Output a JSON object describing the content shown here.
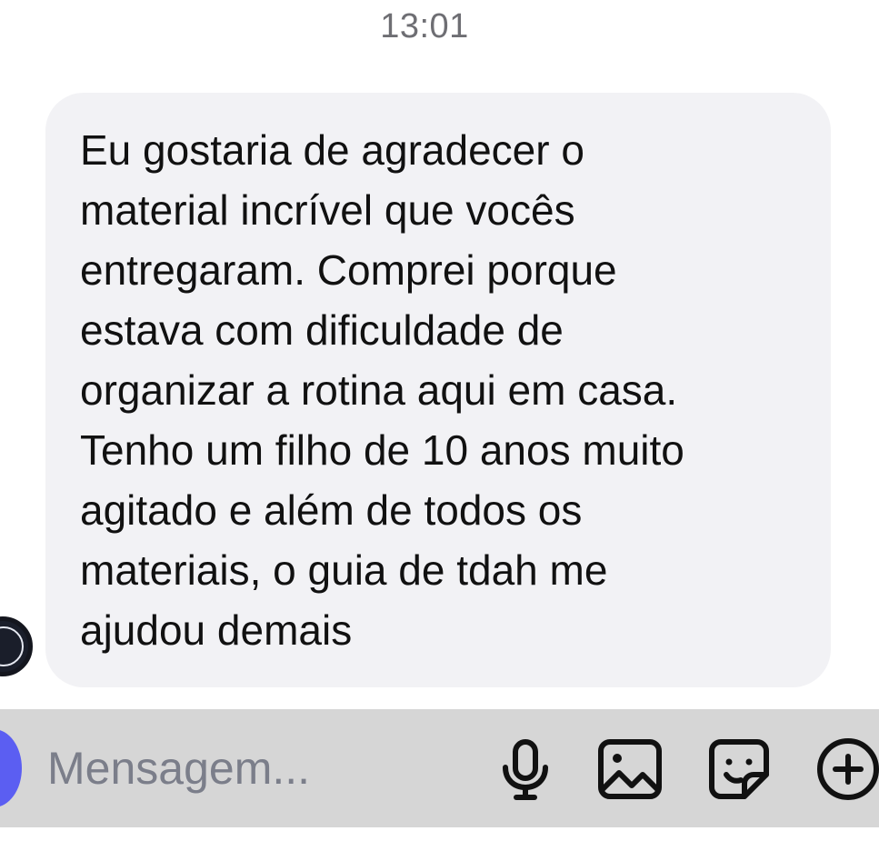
{
  "chat": {
    "timestamp": "13:01",
    "message": {
      "text": "Eu gostaria de agradecer o\nmaterial incrível que vocês\nentregaram. Comprei porque\nestava com dificuldade de\norganizar a rotina aqui em casa.\nTenho um filho de 10 anos muito\nagitado e além de todos os\nmateriais, o guia de tdah me\najudou demais"
    }
  },
  "composer": {
    "placeholder": "Mensagem...",
    "value": "",
    "icons": [
      "microphone-icon",
      "image-icon",
      "sticker-icon",
      "plus-circle-icon"
    ]
  },
  "colors": {
    "background": "#ffffff",
    "bubble": "#f2f2f5",
    "input_bar": "#d6d6d6",
    "accent": "#5b5ef2",
    "icon": "#111111",
    "timestamp": "#6e6e73",
    "placeholder": "#7b7e8a"
  }
}
